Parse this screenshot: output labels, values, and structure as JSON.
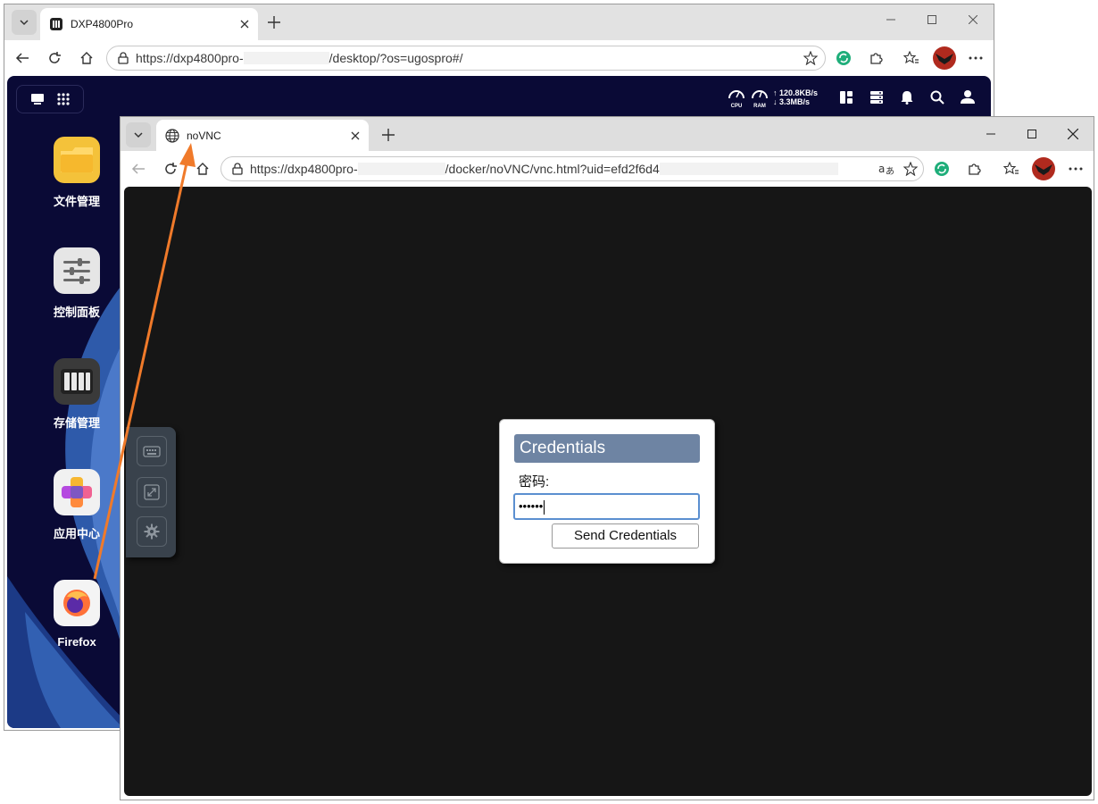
{
  "back_browser": {
    "tab_title": "DXP4800Pro",
    "url_prefix": "https://dxp4800pro-",
    "url_suffix": "/desktop/?os=ugospro#/"
  },
  "nas": {
    "stats": {
      "cpu_label": "CPU",
      "ram_label": "RAM",
      "upload": "↑ 120.8KB/s",
      "download": "↓ 3.3MB/s"
    },
    "apps": [
      {
        "label": "文件管理",
        "icon": "folder-icon"
      },
      {
        "label": "控制面板",
        "icon": "sliders-icon"
      },
      {
        "label": "存储管理",
        "icon": "storage-icon"
      },
      {
        "label": "应用中心",
        "icon": "app-center-icon"
      },
      {
        "label": "Firefox",
        "icon": "firefox-icon"
      }
    ]
  },
  "front_browser": {
    "tab_title": "noVNC",
    "url_prefix": "https://dxp4800pro-",
    "url_suffix": "/docker/noVNC/vnc.html?uid=efd2f6d4"
  },
  "credentials_dialog": {
    "title": "Credentials",
    "password_label": "密码:",
    "password_value": "••••••",
    "submit_label": "Send Credentials"
  },
  "colors": {
    "nas_background": "#0a0a36",
    "dialog_header": "#6e84a3",
    "annotation_arrow": "#f07a2a",
    "vnc_background": "#161616"
  }
}
